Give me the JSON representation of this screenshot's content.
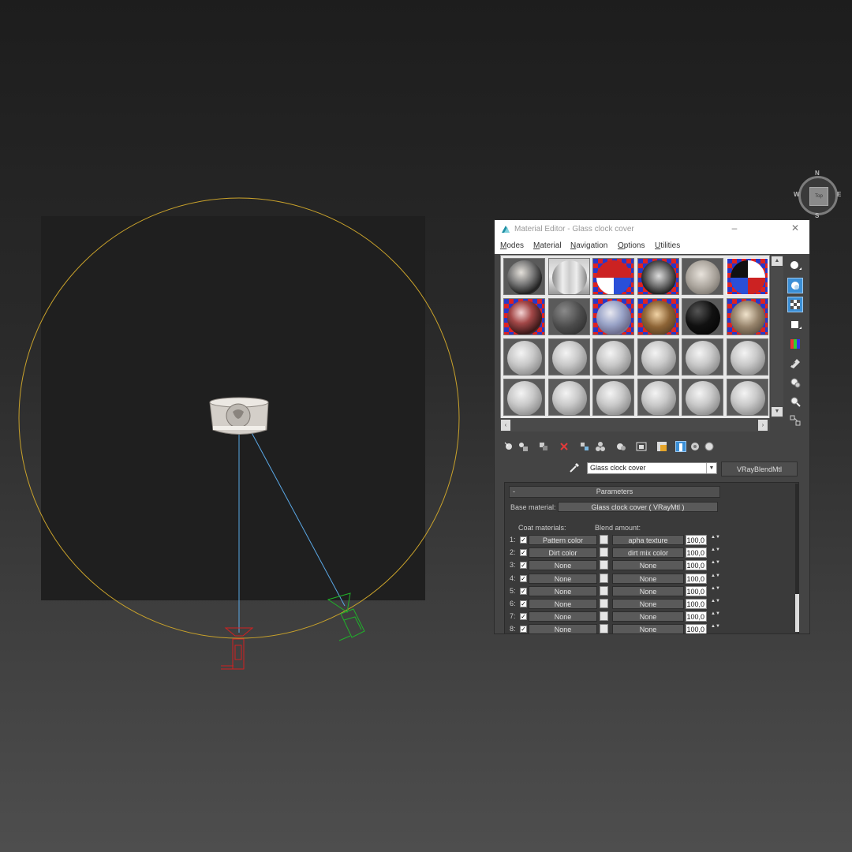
{
  "viewport": {
    "viewcube": {
      "face_label": "Top",
      "n": "N",
      "s": "S",
      "e": "E",
      "w": "W"
    }
  },
  "material_editor": {
    "title": "Material Editor - Glass clock cover",
    "window_buttons": {
      "minimize": "–",
      "close": "✕"
    },
    "menu": [
      "Modes",
      "Material",
      "Navigation",
      "Options",
      "Utilities"
    ],
    "slots": [
      {
        "type": "pattern-sphere"
      },
      {
        "type": "hall-env"
      },
      {
        "type": "checker-sphere"
      },
      {
        "type": "checker-object"
      },
      {
        "type": "clock-object"
      },
      {
        "type": "checker-sphere-selected"
      },
      {
        "type": "glass-sphere"
      },
      {
        "type": "dark-gray"
      },
      {
        "type": "checker-light"
      },
      {
        "type": "bronze-object"
      },
      {
        "type": "black-sphere"
      },
      {
        "type": "metal-object"
      },
      {
        "type": "default"
      },
      {
        "type": "default"
      },
      {
        "type": "default"
      },
      {
        "type": "default"
      },
      {
        "type": "default"
      },
      {
        "type": "default"
      },
      {
        "type": "default"
      },
      {
        "type": "default"
      },
      {
        "type": "default"
      },
      {
        "type": "default"
      },
      {
        "type": "default"
      },
      {
        "type": "default"
      }
    ],
    "name_field": "Glass clock cover",
    "type_button": "VRayBlendMtl",
    "parameters": {
      "rollout_title": "Parameters",
      "rollout_toggle": "-",
      "base_material_label": "Base material:",
      "base_material_value": "Glass clock cover  ( VRayMtl )",
      "coat_header": "Coat materials:",
      "blend_header": "Blend amount:",
      "rows": [
        {
          "num": "1:",
          "coat": "Pattern color",
          "blend": "apha texture",
          "amount": "100,0"
        },
        {
          "num": "2:",
          "coat": "Dirt color",
          "blend": "dirt mix color",
          "amount": "100,0"
        },
        {
          "num": "3:",
          "coat": "None",
          "blend": "None",
          "amount": "100,0"
        },
        {
          "num": "4:",
          "coat": "None",
          "blend": "None",
          "amount": "100,0"
        },
        {
          "num": "5:",
          "coat": "None",
          "blend": "None",
          "amount": "100,0"
        },
        {
          "num": "6:",
          "coat": "None",
          "blend": "None",
          "amount": "100,0"
        },
        {
          "num": "7:",
          "coat": "None",
          "blend": "None",
          "amount": "100,0"
        },
        {
          "num": "8:",
          "coat": "None",
          "blend": "None",
          "amount": "100,0"
        }
      ]
    }
  }
}
